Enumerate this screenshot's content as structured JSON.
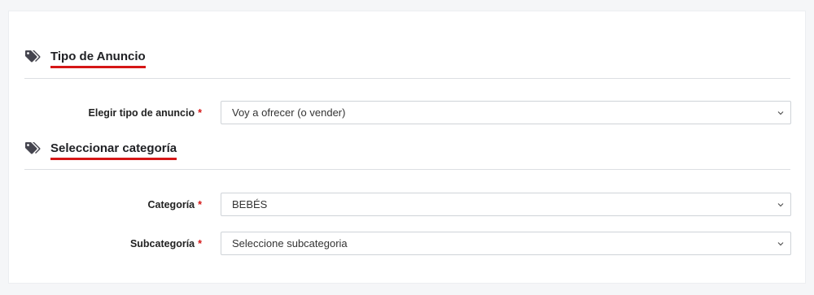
{
  "sections": [
    {
      "title": "Tipo de Anuncio",
      "icon": "tags-icon",
      "fields": [
        {
          "label": "Elegir tipo de anuncio",
          "required": "*",
          "value": "Voy a ofrecer (o vender)"
        }
      ]
    },
    {
      "title": "Seleccionar categoría",
      "icon": "tags-icon",
      "fields": [
        {
          "label": "Categoría",
          "required": "*",
          "value": "BEBÉS"
        },
        {
          "label": "Subcategoría",
          "required": "*",
          "value": "Seleccione subcategoria"
        }
      ]
    }
  ],
  "colors": {
    "accent_underline": "#d51616",
    "required_mark": "#d51616",
    "icon": "#45454f"
  }
}
